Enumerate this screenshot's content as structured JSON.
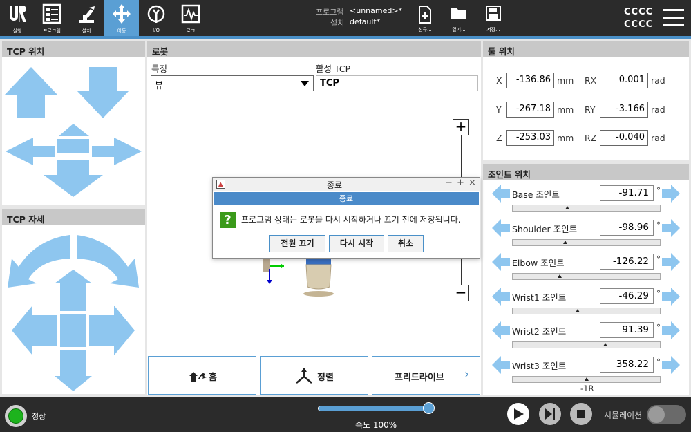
{
  "nav": [
    {
      "label": "실행",
      "icon": "ur-logo-icon"
    },
    {
      "label": "프로그램",
      "icon": "program-icon"
    },
    {
      "label": "설치",
      "icon": "installation-icon"
    },
    {
      "label": "이동",
      "icon": "move-icon"
    },
    {
      "label": "I/O",
      "icon": "io-icon"
    },
    {
      "label": "로그",
      "icon": "log-icon"
    }
  ],
  "header": {
    "program_label": "프로그램",
    "program_value": "<unnamed>*",
    "install_label": "설치",
    "install_value": "default*",
    "new_label": "신규...",
    "open_label": "열기...",
    "save_label": "저장...",
    "user_line1": "CCCC",
    "user_line2": "CCCC"
  },
  "tcp_position": {
    "title": "TCP 위치"
  },
  "tcp_orientation": {
    "title": "TCP 자세"
  },
  "robot": {
    "title": "로봇",
    "feature_label": "특징",
    "feature_value": "뷰",
    "active_tcp_label": "활성 TCP",
    "active_tcp_value": "TCP",
    "zoom_in": "+",
    "zoom_out": "−",
    "home_label": "홈",
    "align_label": "정렬",
    "freedrive_label": "프리드라이브",
    "freedrive_arrow": "›"
  },
  "tool_position": {
    "title": "툴 위치",
    "x_label": "X",
    "x_value": "-136.86",
    "x_unit": "mm",
    "y_label": "Y",
    "y_value": "-267.18",
    "y_unit": "mm",
    "z_label": "Z",
    "z_value": "-253.03",
    "z_unit": "mm",
    "rx_label": "RX",
    "rx_value": "0.001",
    "rx_unit": "rad",
    "ry_label": "RY",
    "ry_value": "-3.166",
    "ry_unit": "rad",
    "rz_label": "RZ",
    "rz_value": "-0.040",
    "rz_unit": "rad"
  },
  "joints": {
    "title": "조인트 위치",
    "degree_symbol": "°",
    "items": [
      {
        "name": "Base 조인트",
        "value": "-91.71",
        "marker_fraction": 0.37
      },
      {
        "name": "Shoulder 조인트",
        "value": "-98.96",
        "marker_fraction": 0.36
      },
      {
        "name": "Elbow 조인트",
        "value": "-126.22",
        "marker_fraction": 0.32
      },
      {
        "name": "Wrist1 조인트",
        "value": "-46.29",
        "marker_fraction": 0.44
      },
      {
        "name": "Wrist2 조인트",
        "value": "91.39",
        "marker_fraction": 0.63
      },
      {
        "name": "Wrist3 조인트",
        "value": "358.22",
        "marker_fraction": 0.5
      }
    ],
    "wrist3_range_label": "-1R"
  },
  "dialog": {
    "title": "종료",
    "banner": "종료",
    "message": "프로그램 상태는 로봇을 다시 시작하거나 끄기 전에 저장됩니다.",
    "question_mark": "?",
    "btn_power_off": "전원 끄기",
    "btn_restart": "다시 시작",
    "btn_cancel": "취소",
    "win_minimize": "−",
    "win_maximize": "+",
    "win_close": "×"
  },
  "footer": {
    "status": "정상",
    "speed_label": "속도 100%",
    "speed_fraction": 1.0,
    "simulation_label": "시뮬레이션"
  },
  "colors": {
    "accent": "#5a9fd4",
    "arrow": "#8ec6ef",
    "status_ok": "#1db31d",
    "dialog_banner": "#4a8ac9",
    "question": "#3a9a1a"
  }
}
